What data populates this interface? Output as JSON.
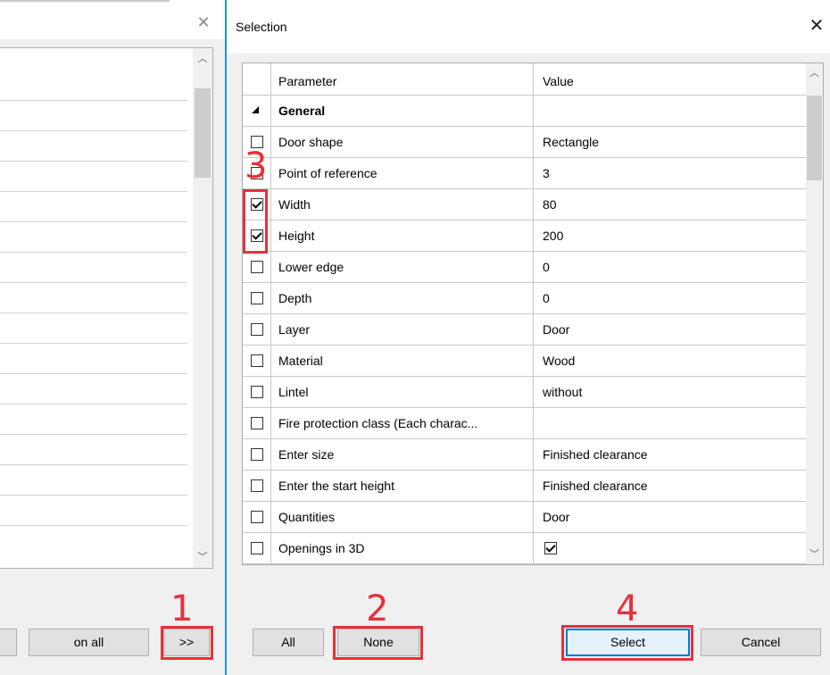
{
  "left_dialog": {
    "rows": 15,
    "buttons": {
      "on_all": "on all",
      "move_right": ">>"
    },
    "icons": {
      "close": "close-icon",
      "scroll_up": "chevron-up-icon",
      "scroll_down": "chevron-down-icon"
    }
  },
  "selection_dialog": {
    "title": "Selection",
    "columns": {
      "parameter": "Parameter",
      "value": "Value"
    },
    "group": "General",
    "rows": [
      {
        "parameter": "Door shape",
        "value": "Rectangle",
        "checked": false
      },
      {
        "parameter": "Point of reference",
        "value": "3",
        "checked": false
      },
      {
        "parameter": "Width",
        "value": "80",
        "checked": true
      },
      {
        "parameter": "Height",
        "value": "200",
        "checked": true
      },
      {
        "parameter": "Lower edge",
        "value": "0",
        "checked": false
      },
      {
        "parameter": "Depth",
        "value": "0",
        "checked": false
      },
      {
        "parameter": "Layer",
        "value": "Door",
        "checked": false
      },
      {
        "parameter": "Material",
        "value": "Wood",
        "checked": false
      },
      {
        "parameter": "Lintel",
        "value": "without",
        "checked": false
      },
      {
        "parameter": "Fire protection class (Each charac...",
        "value": "",
        "checked": false
      },
      {
        "parameter": "Enter size",
        "value": "Finished clearance",
        "checked": false
      },
      {
        "parameter": "Enter the start height",
        "value": "Finished clearance",
        "checked": false
      },
      {
        "parameter": "Quantities",
        "value": "Door",
        "checked": false
      },
      {
        "parameter": "Openings in 3D",
        "value": "",
        "value_checkbox": true,
        "checked": false
      }
    ],
    "buttons": {
      "all": "All",
      "none": "None",
      "select": "Select",
      "cancel": "Cancel"
    },
    "icons": {
      "close": "close-icon",
      "group_toggle": "triangle-collapse-icon",
      "scroll_up": "chevron-up-icon",
      "scroll_down": "chevron-down-icon"
    }
  },
  "annotations": {
    "step1": "1",
    "step2": "2",
    "step3": "3",
    "step4": "4",
    "color": "#e8303a"
  },
  "colors": {
    "accent": "#0078d7",
    "window_separator": "#1e90e3"
  }
}
